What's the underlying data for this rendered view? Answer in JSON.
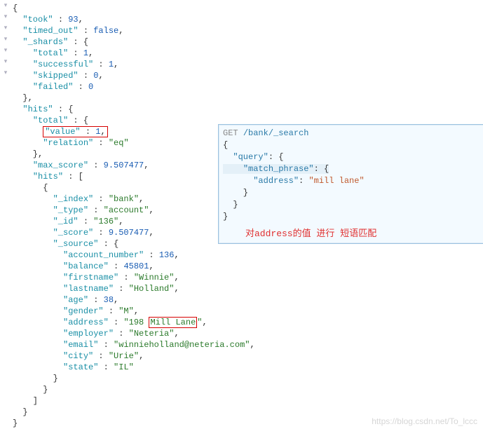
{
  "gutter_marks": [
    "▾",
    "",
    "",
    "▾",
    "",
    "",
    "",
    "",
    "",
    "▾",
    "▾",
    "",
    "",
    "",
    "",
    "",
    "▾",
    "▾",
    "",
    "",
    "",
    "",
    "",
    "▾",
    "",
    "",
    "",
    "",
    "",
    "",
    "",
    "",
    "",
    "",
    "",
    "",
    "",
    "",
    "",
    "",
    "",
    "",
    ""
  ],
  "json": {
    "brace_open": "{",
    "took_key": "\"took\"",
    "took_val": "93",
    "timed_out_key": "\"timed_out\"",
    "timed_out_val": "false",
    "shards_key": "\"_shards\"",
    "shards_total_key": "\"total\"",
    "shards_total_val": "1",
    "shards_successful_key": "\"successful\"",
    "shards_successful_val": "1",
    "shards_skipped_key": "\"skipped\"",
    "shards_skipped_val": "0",
    "shards_failed_key": "\"failed\"",
    "shards_failed_val": "0",
    "hits_key": "\"hits\"",
    "total_key": "\"total\"",
    "value_key": "\"value\"",
    "value_val": "1",
    "relation_key": "\"relation\"",
    "relation_val": "\"eq\"",
    "max_score_key": "\"max_score\"",
    "max_score_val": "9.507477",
    "hits_arr_key": "\"hits\"",
    "idx_key": "\"_index\"",
    "idx_val": "\"bank\"",
    "type_key": "\"_type\"",
    "type_val": "\"account\"",
    "id_key": "\"_id\"",
    "id_val": "\"136\"",
    "score_key": "\"_score\"",
    "score_val": "9.507477",
    "source_key": "\"_source\"",
    "acct_key": "\"account_number\"",
    "acct_val": "136",
    "bal_key": "\"balance\"",
    "bal_val": "45801",
    "fn_key": "\"firstname\"",
    "fn_val": "\"Winnie\"",
    "ln_key": "\"lastname\"",
    "ln_val": "\"Holland\"",
    "age_key": "\"age\"",
    "age_val": "38",
    "gender_key": "\"gender\"",
    "gender_val": "\"M\"",
    "addr_key": "\"address\"",
    "addr_val_a": "\"198 ",
    "addr_val_b": "Mill Lane",
    "addr_val_c": "\"",
    "emp_key": "\"employer\"",
    "emp_val": "\"Neteria\"",
    "email_key": "\"email\"",
    "email_val": "\"winnieholland@neteria.com\"",
    "city_key": "\"city\"",
    "city_val": "\"Urie\"",
    "state_key": "\"state\"",
    "state_val": "\"IL\""
  },
  "panel": {
    "method": "GET",
    "url": "/bank/_search",
    "query_key": "\"query\"",
    "mp_key": "\"match_phrase\"",
    "addr_key": "\"address\"",
    "addr_val": "\"mill lane\"",
    "note": "对address的值 进行 短语匹配"
  },
  "watermark": "https://blog.csdn.net/To_lccc"
}
